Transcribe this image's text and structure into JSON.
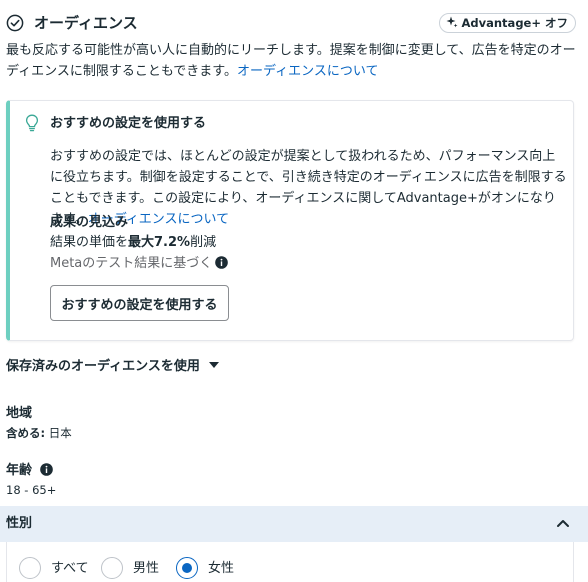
{
  "header": {
    "title": "オーディエンス",
    "badge": "Advantage+ オフ"
  },
  "description": {
    "text": "最も反応する可能性が高い人に自動的にリーチします。提案を制御に変更して、広告を特定のオーディエンスに制限することもできます。",
    "link": "オーディエンスについて"
  },
  "recommendation": {
    "title": "おすすめの設定を使用する",
    "body": "おすすめの設定では、ほとんどの設定が提案として扱われるため、パフォーマンス向上に役立ちます。制御を設定することで、引き続き特定のオーディエンスに広告を制限することもできます。この設定により、オーディエンスに関してAdvantage+がオンになります。",
    "body_link": "オーディエンスについて",
    "results_title": "成果の見込み",
    "results_prefix": "結果の単価を",
    "results_bold": "最大7.2%",
    "results_suffix": "削減",
    "meta_note": "Metaのテスト結果に基づく",
    "button_label": "おすすめの設定を使用する"
  },
  "saved_audience": {
    "label": "保存済みのオーディエンスを使用"
  },
  "region": {
    "label": "地域",
    "include_label": "含める:",
    "value": "日本"
  },
  "age": {
    "label": "年齢",
    "value": "18 - 65+"
  },
  "gender": {
    "title": "性別",
    "options": [
      "すべて",
      "男性",
      "女性"
    ],
    "selected": "女性"
  },
  "colors": {
    "accent": "#0a66c2",
    "teal_border": "#6dcfc0",
    "section_bg": "#e6eef7"
  }
}
